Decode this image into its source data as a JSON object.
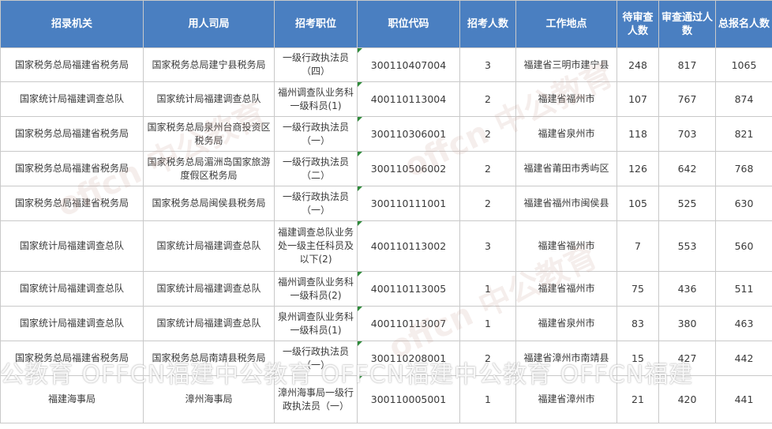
{
  "headers": [
    "招录机关",
    "用人司局",
    "招考职位",
    "职位代码",
    "招考人数",
    "工作地点",
    "待审查人数",
    "审查通过人数",
    "总报名人数"
  ],
  "rows": [
    {
      "agency": "国家税务总局福建省税务局",
      "dept": "国家税务总局建宁县税务局",
      "position": "一级行政执法员（四）",
      "code": "300110407004",
      "count": "3",
      "location": "福建省三明市建宁县",
      "pending": "248",
      "passed": "817",
      "total": "1065"
    },
    {
      "agency": "国家统计局福建调查总队",
      "dept": "国家统计局福建调查总队",
      "position": "福州调查队业务科一级科员(1)",
      "code": "400110113004",
      "count": "2",
      "location": "福建省福州市",
      "pending": "107",
      "passed": "767",
      "total": "874"
    },
    {
      "agency": "国家税务总局福建省税务局",
      "dept": "国家税务总局泉州台商投资区税务局",
      "position": "一级行政执法员（一）",
      "code": "300110306001",
      "count": "2",
      "location": "福建省泉州市",
      "pending": "118",
      "passed": "703",
      "total": "821"
    },
    {
      "agency": "国家税务总局福建省税务局",
      "dept": "国家税务总局湄洲岛国家旅游度假区税务局",
      "position": "一级行政执法员（二）",
      "code": "300110506002",
      "count": "2",
      "location": "福建省莆田市秀屿区",
      "pending": "126",
      "passed": "642",
      "total": "768"
    },
    {
      "agency": "国家税务总局福建省税务局",
      "dept": "国家税务总局闽侯县税务局",
      "position": "一级行政执法员（一）",
      "code": "300110111001",
      "count": "2",
      "location": "福建省福州市闽侯县",
      "pending": "105",
      "passed": "525",
      "total": "630"
    },
    {
      "agency": "国家统计局福建调查总队",
      "dept": "国家统计局福建调查总队",
      "position": "福建调查总队业务处一级主任科员及以下(2)",
      "code": "400110113002",
      "count": "3",
      "location": "福建省福州市",
      "pending": "7",
      "passed": "553",
      "total": "560"
    },
    {
      "agency": "国家统计局福建调查总队",
      "dept": "国家统计局福建调查总队",
      "position": "福州调查队业务科一级科员(2)",
      "code": "400110113005",
      "count": "1",
      "location": "福建省福州市",
      "pending": "75",
      "passed": "436",
      "total": "511"
    },
    {
      "agency": "国家统计局福建调查总队",
      "dept": "国家统计局福建调查总队",
      "position": "泉州调查队业务科一级科员(1)",
      "code": "400110113007",
      "count": "1",
      "location": "福建省泉州市",
      "pending": "83",
      "passed": "380",
      "total": "463"
    },
    {
      "agency": "国家税务总局福建省税务局",
      "dept": "国家税务总局南靖县税务局",
      "position": "一级行政执法员（一）",
      "code": "300110208001",
      "count": "2",
      "location": "福建省漳州市南靖县",
      "pending": "15",
      "passed": "427",
      "total": "442"
    },
    {
      "agency": "福建海事局",
      "dept": "漳州海事局",
      "position": "漳州海事局一级行政执法员（一）",
      "code": "300110005001",
      "count": "1",
      "location": "福建省漳州市",
      "pending": "21",
      "passed": "420",
      "total": "441"
    }
  ],
  "watermark": "公教育 OFFCN福建中公教育 OFFCN福建中公教育 OFFCN福建",
  "faint_watermark": "offcn 中公教育"
}
